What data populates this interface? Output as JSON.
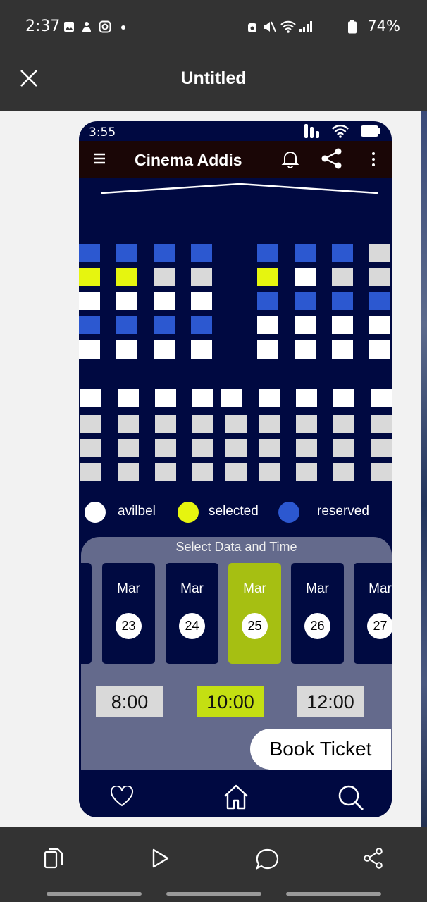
{
  "status_bar": {
    "time": "2:37",
    "battery": "74%"
  },
  "viewer": {
    "title": "Untitled"
  },
  "app": {
    "phone_time": "3:55",
    "title": "Cinema Addis",
    "legend": {
      "available": "avilbel",
      "selected": "selected",
      "reserved": "reserved"
    },
    "booking": {
      "header": "Select Data and Time",
      "dates": [
        {
          "month": "Mar",
          "day": "23"
        },
        {
          "month": "Mar",
          "day": "24"
        },
        {
          "month": "Mar",
          "day": "25"
        },
        {
          "month": "Mar",
          "day": "26"
        },
        {
          "month": "Mar",
          "day": "27"
        }
      ],
      "selected_date_index": 2,
      "times": [
        "8:00",
        "10:00",
        "12:00"
      ],
      "selected_time_index": 1,
      "book_label": "Book Ticket"
    }
  },
  "colors": {
    "available": "#ffffff",
    "selected": "#e6f50f",
    "reserved": "#2c58d0",
    "background": "#000941",
    "accent": "#a6bf12"
  }
}
